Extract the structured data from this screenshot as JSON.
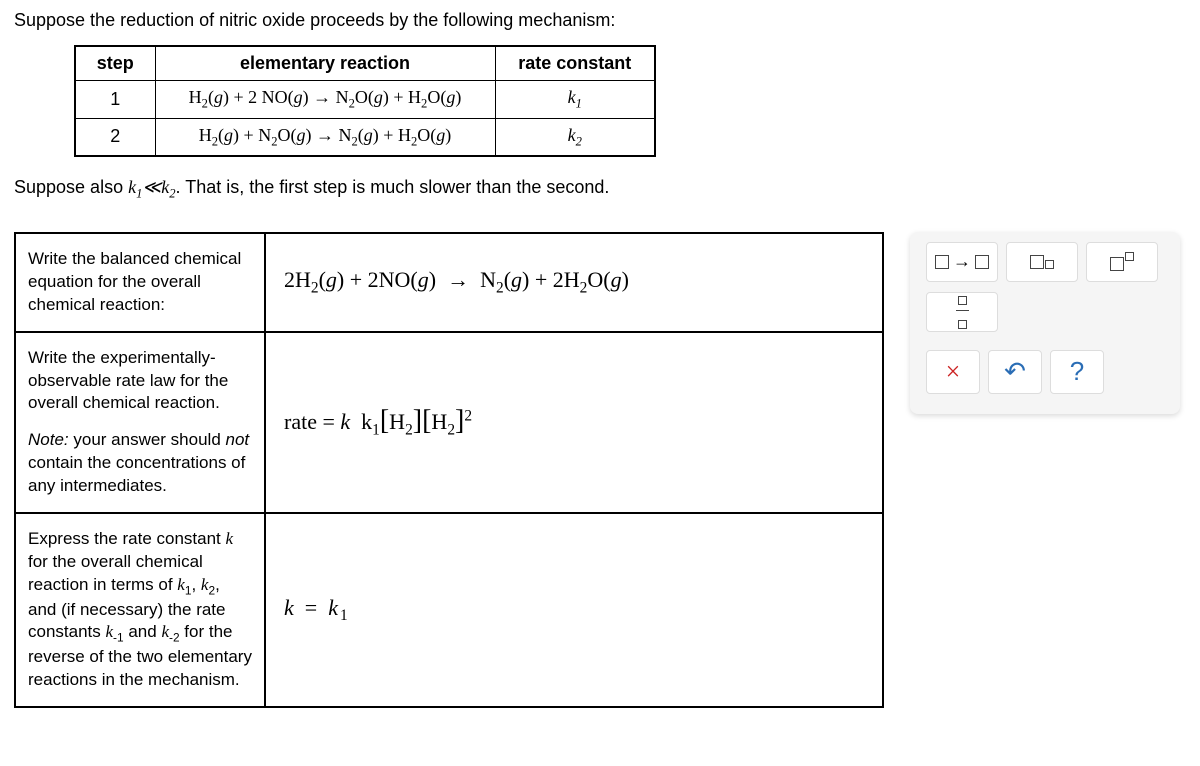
{
  "intro": "Suppose the reduction of nitric oxide proceeds by the following mechanism:",
  "table": {
    "headers": {
      "step": "step",
      "reaction": "elementary reaction",
      "rate": "rate constant"
    },
    "rows": [
      {
        "step": "1",
        "reaction": "H₂(g) + 2 NO(g) → N₂O(g) + H₂O(g)",
        "rate": "k₁"
      },
      {
        "step": "2",
        "reaction": "H₂(g) + N₂O(g) → N₂(g) + H₂O(g)",
        "rate": "k₂"
      }
    ]
  },
  "suppose_prefix": "Suppose also ",
  "suppose_math": "k₁≪k₂",
  "suppose_suffix": ". That is, the first step is much slower than the second.",
  "prompts": {
    "p1": "Write the balanced chemical equation for the overall chemical reaction:",
    "p2": "Write the experimentally-observable rate law for the overall chemical reaction.",
    "p2_note_label": "Note:",
    "p2_note_text": " your answer should ",
    "p2_note_not": "not",
    "p2_note_rest": " contain the concentrations of any intermediates.",
    "p3_a": "Express the rate constant ",
    "p3_b": " for the overall chemical reaction in terms of ",
    "p3_c": ", and (if necessary) the rate constants ",
    "p3_d": " and ",
    "p3_e": " for the reverse of the two elementary reactions in the mechanism.",
    "k": "k",
    "k1": "k₁",
    "k2": "k₂",
    "km1": "k₋₁",
    "km2": "k₋₂"
  },
  "answers": {
    "a1": "2H₂(g) + 2NO(g) → N₂(g) + 2H₂O(g)",
    "a2": "rate = k k₁[H₂][H₂]²",
    "a3": "k  =  k₁"
  },
  "toolbox": {
    "arrow": "→",
    "clear": "×",
    "undo": "↶",
    "help": "?"
  }
}
